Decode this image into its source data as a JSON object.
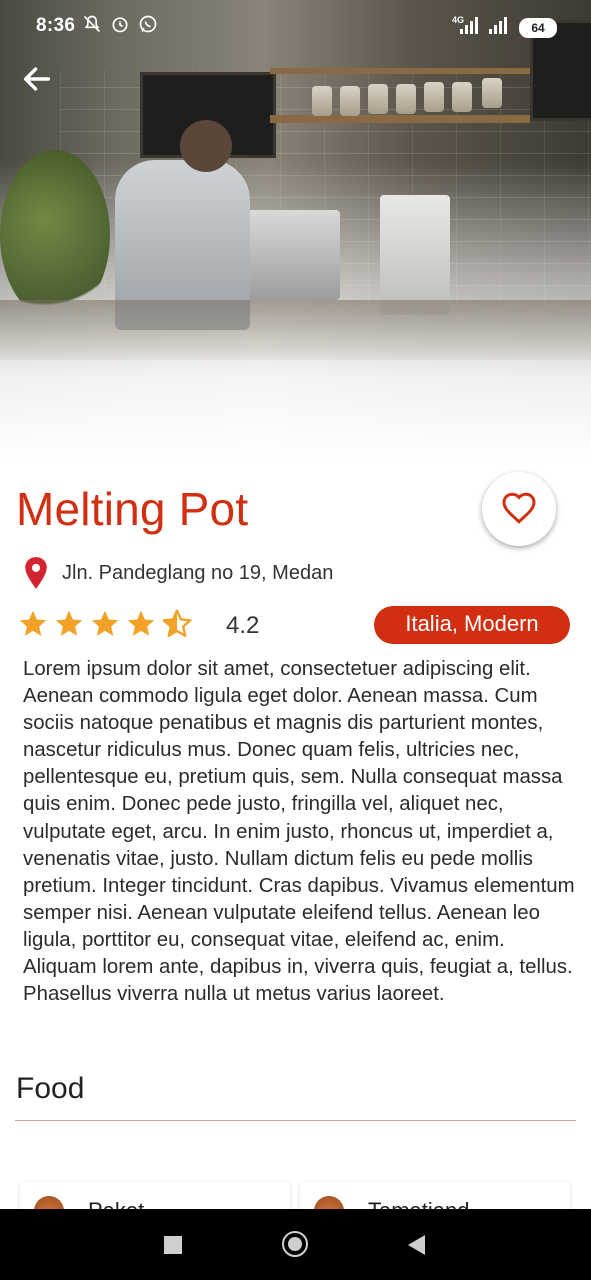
{
  "status_bar": {
    "time": "8:36",
    "network": "4G",
    "battery": "64"
  },
  "restaurant": {
    "name": "Melting Pot",
    "address": "Jln. Pandeglang no 19, Medan",
    "rating": 4.2,
    "rating_label": "4.2",
    "stars_filled": 4.5,
    "cuisine_tag": "Italia, Modern",
    "description": "Lorem ipsum dolor sit amet, consectetuer adipiscing elit. Aenean commodo ligula eget dolor. Aenean massa. Cum sociis natoque penatibus et magnis dis parturient montes, nascetur ridiculus mus. Donec quam felis, ultricies nec, pellentesque eu, pretium quis, sem. Nulla consequat massa quis enim. Donec pede justo, fringilla vel, aliquet nec, vulputate eget, arcu. In enim justo, rhoncus ut, imperdiet a, venenatis vitae, justo. Nullam dictum felis eu pede mollis pretium. Integer tincidunt. Cras dapibus. Vivamus elementum semper nisi. Aenean vulputate eleifend tellus. Aenean leo ligula, porttitor eu, consequat vitae, eleifend ac, enim. Aliquam lorem ante, dapibus in, viverra quis, feugiat a, tellus. Phasellus viverra nulla ut metus varius laoreet."
  },
  "menu": {
    "section_title": "Food",
    "items": [
      {
        "label": "Paket",
        "icon": "food-icon"
      },
      {
        "label": "Tamatiand",
        "icon": "food-icon"
      }
    ]
  },
  "colors": {
    "accent": "#d12e12",
    "star": "#f2a327",
    "pin": "#d3232f"
  }
}
